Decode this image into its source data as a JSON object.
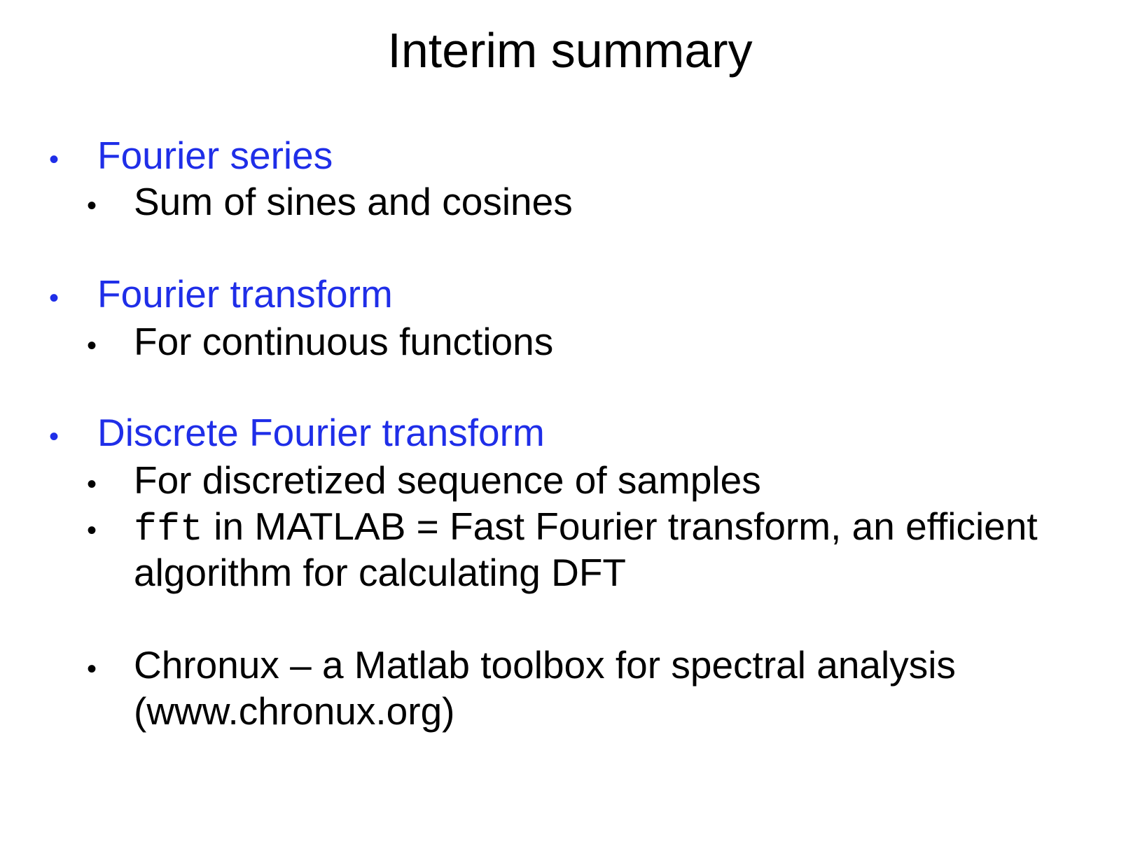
{
  "slide": {
    "title": "Interim summary",
    "bullet_glyph": "•",
    "sections": [
      {
        "heading": "Fourier series",
        "items": [
          "Sum of sines and cosines"
        ]
      },
      {
        "heading": "Fourier transform",
        "items": [
          "For continuous functions"
        ]
      },
      {
        "heading": "Discrete Fourier transform",
        "items": [
          "For discretized sequence of samples",
          {
            "code": "fft",
            "text_line1": " in MATLAB = Fast Fourier transform, an efficient",
            "text_line2": "algorithm for calculating DFT"
          }
        ]
      }
    ],
    "extra": {
      "line1": "Chronux – a Matlab toolbox for spectral analysis",
      "line2": "(www.chronux.org)"
    }
  },
  "colors": {
    "heading_blue": "#1f2ee8",
    "text_black": "#000000",
    "background": "#ffffff"
  }
}
